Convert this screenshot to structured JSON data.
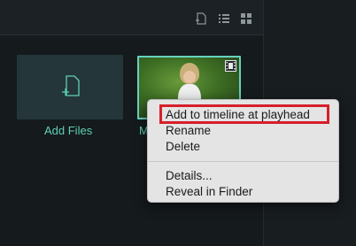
{
  "toolbar": {
    "icons": [
      "add-file-icon",
      "list-view-icon",
      "grid-view-icon"
    ],
    "icon_color": "#8e979b"
  },
  "media": {
    "tiles": [
      {
        "label": "Add Files",
        "type": "add"
      },
      {
        "label": "M",
        "type": "video"
      }
    ],
    "accent": "#5fd0b6",
    "selected_border": "#66d3c0"
  },
  "context_menu": {
    "items": [
      "Add to timeline at playhead",
      "Rename",
      "Delete",
      "Details...",
      "Reveal in Finder"
    ],
    "highlight_color": "#d61f2a"
  }
}
